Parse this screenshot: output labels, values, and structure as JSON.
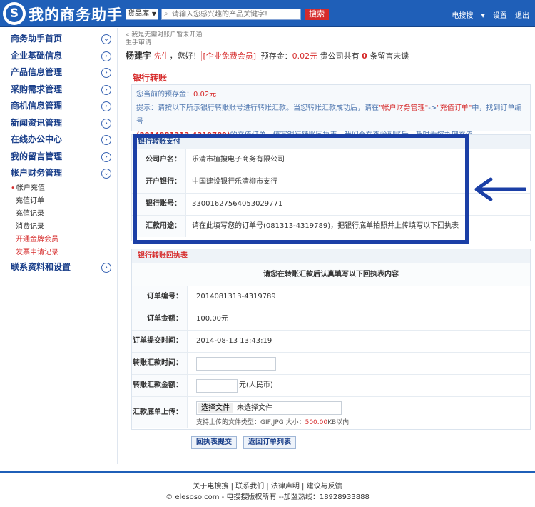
{
  "header": {
    "brand": "我的商务助手",
    "logo_letter": "S",
    "search_category": "货品库",
    "search_placeholder": "请输入您感兴趣的产品关键字!",
    "search_button": "搜索",
    "user_menu": "电搜搜",
    "settings": "设置",
    "logout": "退出"
  },
  "sidebar": {
    "items": [
      {
        "label": "商务助手首页",
        "chev": "⌄"
      },
      {
        "label": "企业基础信息",
        "chev": "›"
      },
      {
        "label": "产品信息管理",
        "chev": "›"
      },
      {
        "label": "采购需求管理",
        "chev": "›"
      },
      {
        "label": "商机信息管理",
        "chev": "›"
      },
      {
        "label": "新闻资讯管理",
        "chev": "›"
      },
      {
        "label": "在线办公中心",
        "chev": "›"
      },
      {
        "label": "我的留言管理",
        "chev": "›"
      },
      {
        "label": "帐户财务管理",
        "chev": "⌄"
      }
    ],
    "sub_items": [
      "帐户充值",
      "充值订单",
      "充值记录",
      "消费记录",
      "开通金牌会员",
      "发票申请记录"
    ],
    "last_item": {
      "label": "联系资料和设置",
      "chev": "›"
    }
  },
  "breadcrumb": {
    "line1": "« 我是无需对账户暂未开通",
    "line2": "生手审请"
  },
  "welcome": {
    "name": "杨建宇",
    "title": "先生",
    "greeting": "，您好！",
    "member": "[企业免费会员]",
    "prepaid_label": "预存金：",
    "prepaid_value": "0.02元",
    "company_prefix": "贵公司共有",
    "message_count": "0",
    "message_suffix": "条留言未读"
  },
  "section_title": "银行转账",
  "info": {
    "balance_label": "您当前的预存金：",
    "balance_value": "0.02元",
    "tip_a": "提示：请按以下所示银行转账账号进行转账汇款。当您转账汇款成功后，请在",
    "tip_b": "\"帐户财务管理\"",
    "tip_c": "->",
    "tip_d": "\"充值订单\"",
    "tip_e": "中，找到订单编号",
    "order_no": "(2014081313-4319789)",
    "tip_f": "的充值订单，填写银行转账回执表，我们会在查验到账后，及时为您办理充值。"
  },
  "pay_panel": {
    "title": "银行转账支付",
    "rows": [
      {
        "label": "公司户名：",
        "value": "乐清市植搜电子商务有限公司"
      },
      {
        "label": "开户银行：",
        "value": "中国建设银行乐清柳市支行"
      },
      {
        "label": "银行账号：",
        "value": "33001627564053029771"
      },
      {
        "label": "汇款用途：",
        "value": "请在此填写您的订单号(081313-4319789)，把银行底单拍照并上传填写以下回执表"
      }
    ]
  },
  "form_panel": {
    "title": "银行转账回执表",
    "note": "请您在转账汇款后认真填写以下回执表内容",
    "order_no_label": "订单编号：",
    "order_no_value": "2014081313-4319789",
    "amount_label": "订单金额：",
    "amount_value": "100.00元",
    "time_label": "订单提交时间：",
    "time_value": "2014-08-13 13:43:19",
    "transfer_time_label": "转账汇款时间：",
    "transfer_amount_label": "转账汇款金额：",
    "transfer_amount_unit": "元(人民币)",
    "upload_label": "汇款底单上传：",
    "file_button": "选择文件",
    "file_status": "未选择文件",
    "file_hint_a": "支持上传的文件类型：GIF,JPG 大小：",
    "file_hint_size": "500.00",
    "file_hint_b": "KB以内"
  },
  "buttons": {
    "submit": "回执表提交",
    "back": "返回订单列表"
  },
  "footer": {
    "links": "关于电搜搜 | 联系我们 | 法律声明 | 建议与反馈",
    "copyright": "© elesoso.com - 电搜搜版权所有 --加盟热线：18928933888"
  }
}
